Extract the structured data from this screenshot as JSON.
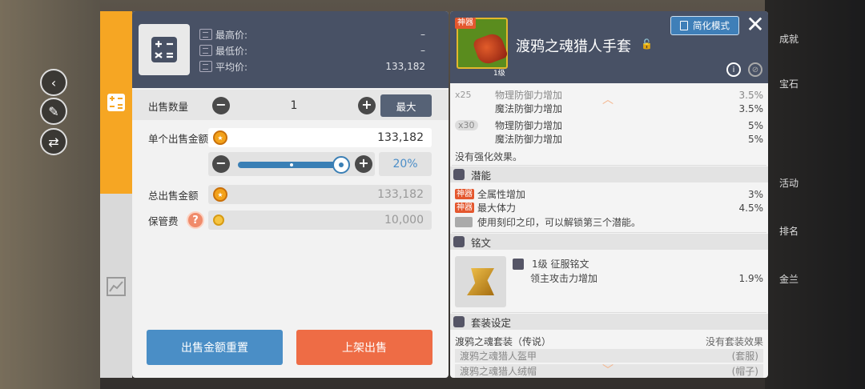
{
  "left": {
    "prices": [
      {
        "label": "最高价:",
        "value": "–"
      },
      {
        "label": "最低价:",
        "value": "–"
      },
      {
        "label": "平均价:",
        "value": "133,182"
      }
    ],
    "quantity_label": "出售数量",
    "quantity_value": "1",
    "max_label": "最大",
    "unit_price_label": "单个出售金额",
    "unit_price_value": "133,182",
    "slider_percent": "20%",
    "slider_level": 0.2,
    "total_label": "总出售金额",
    "total_value": "133,182",
    "fee_label": "保管费",
    "fee_value": "10,000",
    "reset_label": "出售金额重置",
    "list_label": "上架出售",
    "help_symbol": "?"
  },
  "item": {
    "tag": "神器",
    "level": "1级",
    "name": "渡鸦之魂猎人手套",
    "simple_mode_label": "简化模式",
    "close_symbol": "✕"
  },
  "stats": {
    "x25": {
      "count": "x25",
      "lines": [
        {
          "name": "物理防御力增加",
          "value": "3.5%"
        },
        {
          "name": "魔法防御力增加",
          "value": "3.5%"
        }
      ]
    },
    "x30": {
      "count": "x30",
      "lines": [
        {
          "name": "物理防御力增加",
          "value": "5%"
        },
        {
          "name": "魔法防御力增加",
          "value": "5%"
        }
      ]
    },
    "no_enhance": "没有强化效果。"
  },
  "potential": {
    "title": "潜能",
    "lines": [
      {
        "tag": "神器",
        "name": "全属性增加",
        "value": "3%"
      },
      {
        "tag": "神器",
        "name": "最大体力",
        "value": "4.5%"
      }
    ],
    "hint": "使用刻印之印，可以解锁第三个潜能。"
  },
  "inscription": {
    "title": "铭文",
    "name": "1级 征服铭文",
    "effect": "领主攻击力增加",
    "value": "1.9%"
  },
  "set": {
    "title": "套装设定",
    "set_name": "渡鸦之魂套装（传说）",
    "no_effect": "没有套装效果",
    "pieces": [
      {
        "name": "渡鸦之魂猎人盔甲",
        "type": "(套服)"
      },
      {
        "name": "渡鸦之魂猎人绒帽",
        "type": "(帽子)"
      }
    ]
  },
  "background": {
    "right_menu": [
      "成就",
      "宝石",
      "活动",
      "排名",
      "金兰"
    ]
  }
}
